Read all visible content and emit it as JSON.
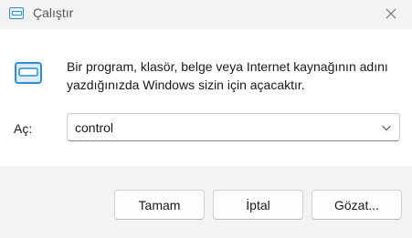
{
  "window": {
    "title": "Çalıştır"
  },
  "content": {
    "description": "Bir program, klasör, belge veya Internet kaynağının adını yazdığınızda Windows sizin için açacaktır.",
    "open_label": "Aç:",
    "open_value": "control"
  },
  "buttons": {
    "ok": "Tamam",
    "cancel": "İptal",
    "browse": "Gözat..."
  },
  "icons": {
    "title": "run-icon",
    "close": "close-icon",
    "dropdown": "chevron-down-icon"
  },
  "colors": {
    "accent": "#2a8fd4"
  }
}
